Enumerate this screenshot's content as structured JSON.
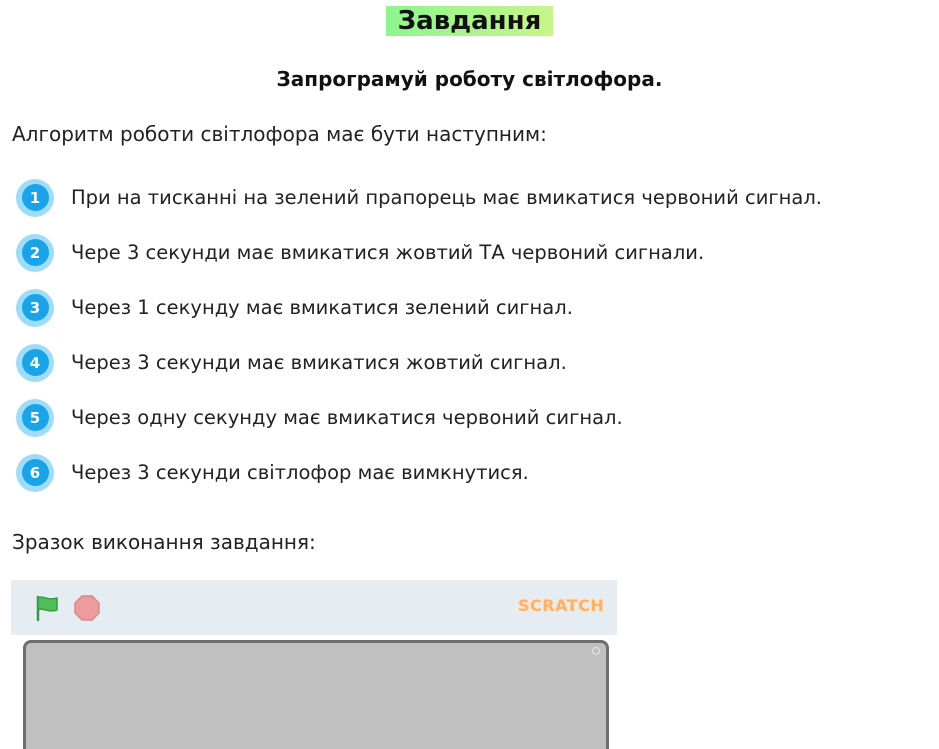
{
  "header": {
    "title": "Завдання",
    "subtitle": "Запрограмуй роботу світлофора."
  },
  "intro": "Алгоритм роботи світлофора має бути наступним:",
  "steps": [
    {
      "num": "1",
      "text": "При на тисканні на зелений прапорець має вмикатися червоний сигнал."
    },
    {
      "num": "2",
      "text": "Чере 3 секунди має вмикатися жовтий ТА червоний сигнали."
    },
    {
      "num": "3",
      "text": "Через 1 секунду має вмикатися зелений сигнал."
    },
    {
      "num": "4",
      "text": "Через 3 секунди має вмикатися жовтий сигнал."
    },
    {
      "num": "5",
      "text": "Через одну секунду має вмикатися червоний сигнал."
    },
    {
      "num": "6",
      "text": "Через 3 секунди світлофор має вимкнутися."
    }
  ],
  "sample_label": "Зразок виконання завдання:",
  "player": {
    "logo_text": "SCRATCH",
    "icons": {
      "flag": "green-flag-icon",
      "stop": "stop-sign-icon"
    }
  },
  "colors": {
    "title_highlight": "#8ef58e",
    "step_badge": "#1aa3e8",
    "step_badge_ring": "#9fdcf8",
    "player_bar": "#e6edf2",
    "stage_bg": "#c0c0c0",
    "flag": "#4cbf56",
    "stop": "#ec9c9c"
  }
}
